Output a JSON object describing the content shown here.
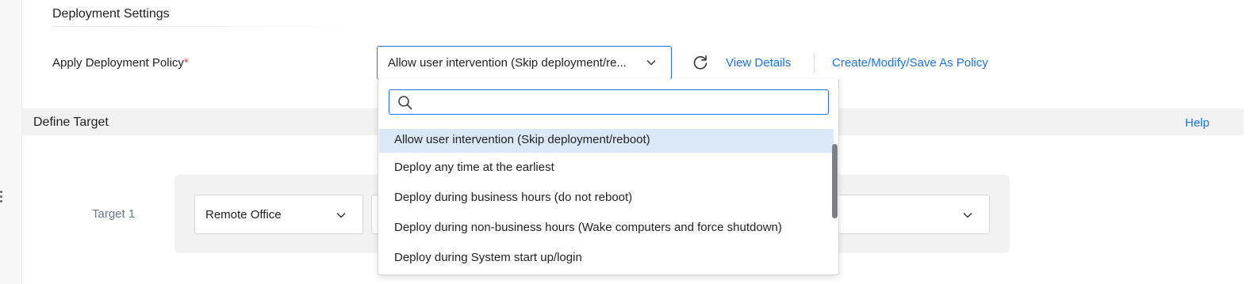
{
  "deployment_settings": {
    "title": "Deployment Settings",
    "policy_label": "Apply Deployment Policy",
    "required_mark": "*",
    "policy_select_value": "Allow user intervention (Skip deployment/re...",
    "view_details": "View Details",
    "create_policy": "Create/Modify/Save As Policy"
  },
  "policy_dropdown": {
    "search_placeholder": "",
    "options": [
      "Allow user intervention (Skip deployment/reboot)",
      "Deploy any time at the earliest",
      "Deploy during business hours (do not reboot)",
      "Deploy during non-business hours (Wake computers and force shutdown)",
      "Deploy during System start up/login"
    ],
    "selected_index": 0
  },
  "define_target": {
    "title": "Define Target",
    "help": "Help",
    "target_label": "Target 1",
    "target_select_value": "Remote Office"
  },
  "colors": {
    "accent": "#1a73e8",
    "required": "#d9534f",
    "selected_bg": "#dbe8f8"
  },
  "icons": [
    "chevron-down-icon",
    "refresh-icon",
    "search-icon"
  ]
}
